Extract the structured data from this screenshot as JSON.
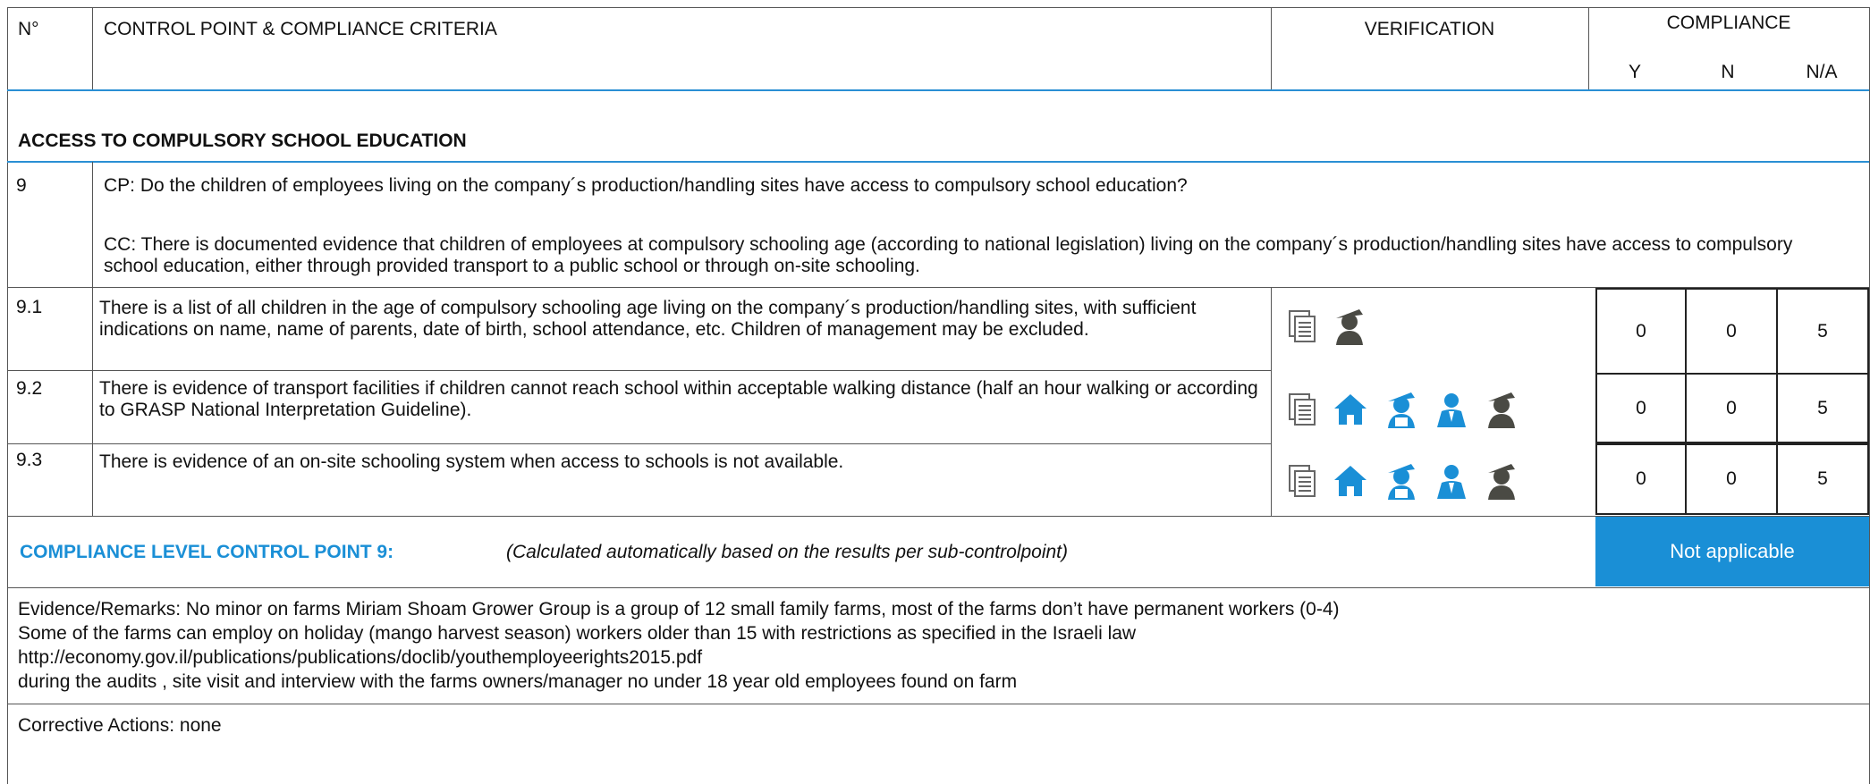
{
  "header": {
    "no": "N°",
    "control_point": "CONTROL POINT & COMPLIANCE CRITERIA",
    "verification": "VERIFICATION",
    "compliance": "COMPLIANCE",
    "y": "Y",
    "n": "N",
    "na": "N/A"
  },
  "section_title": "ACCESS TO COMPULSORY SCHOOL EDUCATION",
  "cp": {
    "number": "9",
    "question": "CP: Do the children of employees living on the company´s production/handling sites have access to compulsory school education?",
    "criteria": "CC: There is documented evidence that children of employees at compulsory schooling age (according to national legislation) living on the company´s production/handling sites have access to compulsory school education, either through provided transport to a public school or through on-site schooling."
  },
  "rows": [
    {
      "number": "9.1",
      "text": "There is a list of all children in the age of compulsory schooling age living on the company´s production/handling sites, with sufficient indications on name, name of parents, date of birth, school attendance, etc. Children of management may be excluded.",
      "icons": [
        "document-icon",
        "worker-hat-icon"
      ],
      "y": "0",
      "n": "0",
      "na": "5"
    },
    {
      "number": "9.2",
      "text": "There is evidence of transport facilities if children cannot reach school within acceptable walking distance (half an hour walking or according to GRASP National Interpretation Guideline).",
      "icons": [
        "document-icon",
        "house-icon",
        "worker-representative-icon",
        "manager-icon",
        "worker-hat-icon"
      ],
      "y": "0",
      "n": "0",
      "na": "5"
    },
    {
      "number": "9.3",
      "text": "There is evidence of an on-site schooling system when access to schools is not available.",
      "icons": [
        "document-icon",
        "house-icon",
        "worker-representative-icon",
        "manager-icon",
        "worker-hat-icon"
      ],
      "y": "0",
      "n": "0",
      "na": "5"
    }
  ],
  "compliance_level": {
    "label": "COMPLIANCE LEVEL CONTROL POINT 9:",
    "note": "(Calculated automatically based on the results per sub-controlpoint)",
    "result": "Not applicable"
  },
  "evidence": {
    "line1": "Evidence/Remarks: No minor on farms Miriam Shoam Grower Group is a group of 12 small family farms, most of the farms don’t have permanent workers (0-4)",
    "line2": "Some of the farms can employ on holiday (mango harvest season) workers older than 15 with restrictions as specified in the Israeli law",
    "line3": "http://economy.gov.il/publications/publications/doclib/youthemployeerights2015.pdf",
    "line4": "during the audits , site visit and interview with the farms owners/manager no under 18 year old employees found on farm"
  },
  "corrective": {
    "text": "Corrective Actions: none"
  },
  "colors": {
    "accent": "#1a8fd6",
    "icon_blue": "#1a8fd6",
    "icon_dark": "#4a4a44",
    "border": "#555555"
  }
}
